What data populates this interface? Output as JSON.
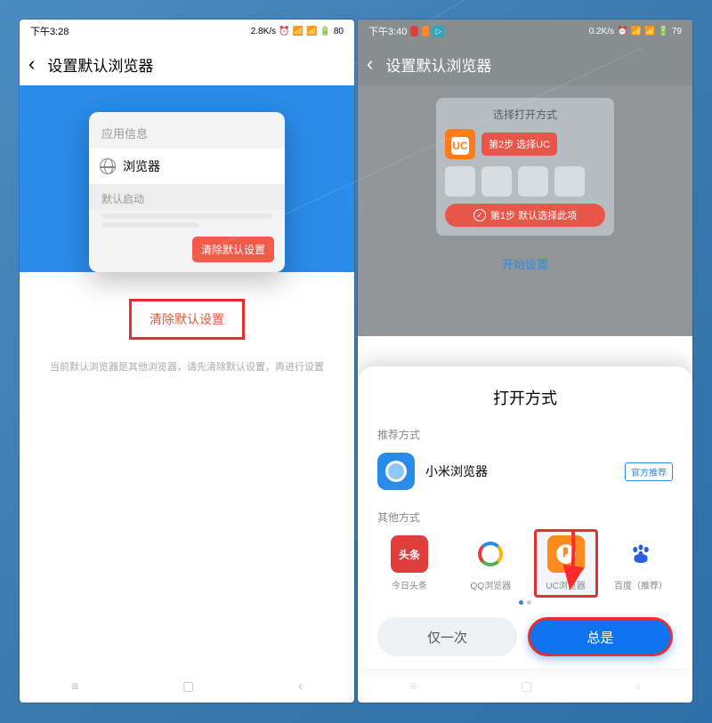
{
  "left": {
    "status": {
      "time": "下午3:28",
      "speed": "2.8K/s",
      "battery": "80"
    },
    "title": "设置默认浏览器",
    "card": {
      "heading": "应用信息",
      "browser": "浏览器",
      "default_launch": "默认启动",
      "clear_chip": "清除默认设置"
    },
    "clear_button": "清除默认设置",
    "hint": "当前默认浏览器是其他浏览器，请先清除默认设置，再进行设置"
  },
  "right": {
    "status": {
      "time": "下午3:40",
      "speed": "0.2K/s",
      "battery": "79"
    },
    "title": "设置默认浏览器",
    "guide": {
      "title": "选择打开方式",
      "uc": "UC",
      "step2": "第2步 选择UC",
      "step1": "第1步 默认选择此项"
    },
    "start": "开始设置",
    "sheet": {
      "title": "打开方式",
      "recommend_label": "推荐方式",
      "mi_name": "小米浏览器",
      "mi_badge": "官方推荐",
      "other_label": "其他方式",
      "options": {
        "toutiao": "今日头条",
        "qq": "QQ浏览器",
        "uc": "UC浏览器",
        "baidu": "百度（推荐）"
      },
      "once": "仅一次",
      "always": "总是"
    }
  },
  "icons": {
    "toutiao_glyph": "头条",
    "baidu_glyph": "⠿"
  }
}
